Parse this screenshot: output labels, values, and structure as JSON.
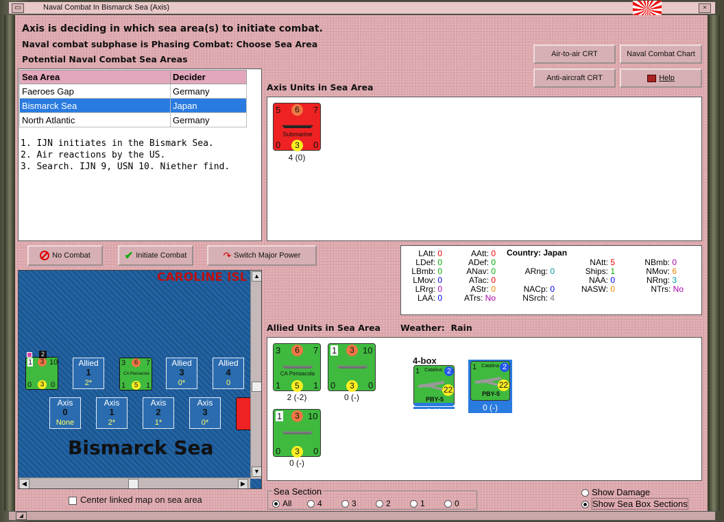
{
  "window": {
    "title": "Naval Combat In Bismarck Sea (Axis)"
  },
  "headers": {
    "line1": "Axis is deciding in which sea area(s) to initiate combat.",
    "line2": "Naval combat subphase is Phasing Combat: Choose Sea Area",
    "line3": "Potential Naval Combat Sea Areas"
  },
  "buttons": {
    "air_to_air": "Air-to-air CRT",
    "naval_chart": "Naval Combat Chart",
    "anti_aircraft": "Anti-aircraft CRT",
    "help": "Help",
    "no_combat": "No Combat",
    "initiate": "Initiate Combat",
    "switch": "Switch Major Power"
  },
  "sea_table": {
    "headers": [
      "Sea Area",
      "Decider"
    ],
    "rows": [
      {
        "area": "Faeroes Gap",
        "decider": "Germany"
      },
      {
        "area": "Bismarck Sea",
        "decider": "Japan"
      },
      {
        "area": "North Atlantic",
        "decider": "Germany"
      }
    ]
  },
  "notes": [
    "1. IJN initiates in the Bismark Sea.",
    "2. Air reactions by the US.",
    "3. Search. IJN 9, USN 10.  Niether find."
  ],
  "axis_panel": {
    "title": "Axis Units in Sea Area",
    "unit": {
      "att": "5",
      "def": "6",
      "mov": "7",
      "name": "Submarine",
      "a": "0",
      "b": "3",
      "c": "0",
      "caption": "4 (0)"
    }
  },
  "allied_panel": {
    "title": "Allied Units in Sea Area",
    "weather_label": "Weather:",
    "weather": "Rain",
    "box_label": "4-box",
    "units": [
      {
        "top": [
          "3",
          "6",
          "7"
        ],
        "name": "CA Pensacola",
        "bottom": [
          "1",
          "5",
          "1"
        ],
        "caption": "2 (-2)"
      },
      {
        "top": [
          "1",
          "3",
          "10"
        ],
        "name": "",
        "bottom": [
          "0",
          "3",
          "0"
        ],
        "caption": "0 (-)"
      },
      {
        "top": [
          "1",
          "3",
          "10"
        ],
        "name": "",
        "bottom": [
          "0",
          "3",
          "0"
        ],
        "caption": "0 (-)"
      }
    ],
    "air_units": [
      {
        "top": [
          "1",
          "2"
        ],
        "name": "Catalina",
        "model": "PBY-5",
        "val": "22",
        "caption": "0 (-)"
      },
      {
        "top": [
          "1",
          "2"
        ],
        "name": "Catalina",
        "model": "PBY-5",
        "val": "22",
        "caption": "0 (-)"
      }
    ]
  },
  "stats": {
    "country_label": "Country:",
    "country": "Japan",
    "items": [
      {
        "k": "LAtt:",
        "v": "0"
      },
      {
        "k": "LDef:",
        "v": "0"
      },
      {
        "k": "LBmb:",
        "v": "0"
      },
      {
        "k": "LMov:",
        "v": "0"
      },
      {
        "k": "LRrg:",
        "v": "0"
      },
      {
        "k": "LAA:",
        "v": "0"
      },
      {
        "k": "AAtt:",
        "v": "0"
      },
      {
        "k": "ADef:",
        "v": "0"
      },
      {
        "k": "ANav:",
        "v": "0"
      },
      {
        "k": "ATac:",
        "v": "0"
      },
      {
        "k": "AStr:",
        "v": "0"
      },
      {
        "k": "ATrs:",
        "v": "No"
      },
      {
        "k": "ARng:",
        "v": "0"
      },
      {
        "k": "NACp:",
        "v": "0"
      },
      {
        "k": "NSrch:",
        "v": "4"
      },
      {
        "k": "NAtt:",
        "v": "5"
      },
      {
        "k": "Ships:",
        "v": "1"
      },
      {
        "k": "NAA:",
        "v": "0"
      },
      {
        "k": "NASW:",
        "v": "0"
      },
      {
        "k": "NBmb:",
        "v": "0"
      },
      {
        "k": "NMov:",
        "v": "6"
      },
      {
        "k": "NRng:",
        "v": "3"
      },
      {
        "k": "NTrs:",
        "v": "No"
      }
    ]
  },
  "map": {
    "region": "CAROLINE ISL",
    "sea": "Bismarck Sea",
    "allied_boxes": [
      {
        "title": "Allied",
        "num": "1",
        "sub": "2*"
      },
      {
        "title": "Allied",
        "num": "3",
        "sub": "0*"
      },
      {
        "title": "Allied",
        "num": "4",
        "sub": "0"
      }
    ],
    "axis_boxes": [
      {
        "title": "Axis",
        "num": "0",
        "sub": "None"
      },
      {
        "title": "Axis",
        "num": "1",
        "sub": "2*"
      },
      {
        "title": "Axis",
        "num": "2",
        "sub": "1*"
      },
      {
        "title": "Axis",
        "num": "3",
        "sub": "0*"
      }
    ],
    "mini_unit1": [
      "1",
      "3",
      "10",
      "0",
      "3",
      "0"
    ],
    "mini_unit2": [
      "3",
      "6",
      "7",
      "1",
      "5",
      "1"
    ],
    "mini_unit2_name": "CA Pensacola",
    "badge": "2"
  },
  "controls": {
    "center_map": "Center linked map on sea area",
    "sea_section": "Sea Section",
    "sections": [
      "All",
      "4",
      "3",
      "2",
      "1",
      "0"
    ],
    "show_damage": "Show Damage",
    "show_sections": "Show Sea Box Sections"
  }
}
